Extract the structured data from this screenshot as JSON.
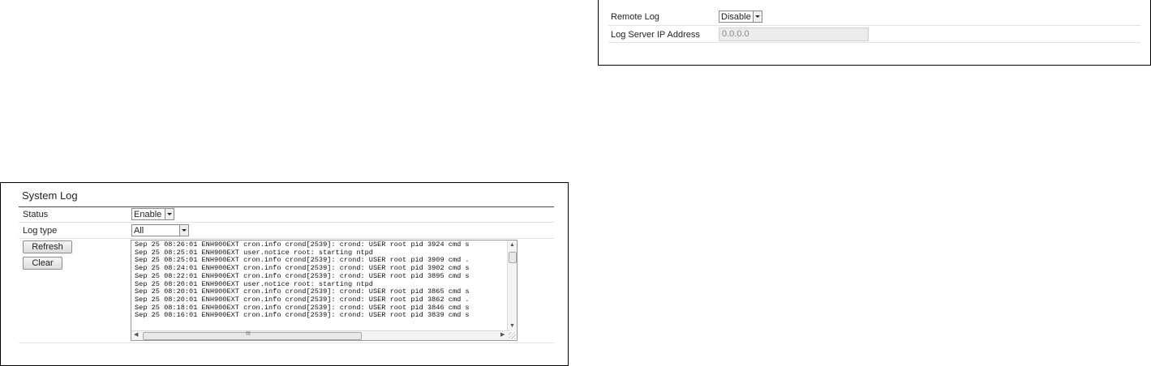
{
  "system_log": {
    "title": "System Log",
    "status_label": "Status",
    "status_value": "Enable",
    "log_type_label": "Log type",
    "log_type_value": "All",
    "refresh_label": "Refresh",
    "clear_label": "Clear",
    "log_lines": [
      "Sep 25 08:26:01 ENH900EXT cron.info crond[2539]: crond: USER root pid 3924 cmd s",
      "Sep 25 08:25:01 ENH900EXT user.notice root: starting ntpd",
      "Sep 25 08:25:01 ENH900EXT cron.info crond[2539]: crond: USER root pid 3909 cmd .",
      "Sep 25 08:24:01 ENH900EXT cron.info crond[2539]: crond: USER root pid 3902 cmd s",
      "Sep 25 08:22:01 ENH900EXT cron.info crond[2539]: crond: USER root pid 3895 cmd s",
      "Sep 25 08:20:01 ENH900EXT user.notice root: starting ntpd",
      "Sep 25 08:20:01 ENH900EXT cron.info crond[2539]: crond: USER root pid 3865 cmd s",
      "Sep 25 08:20:01 ENH900EXT cron.info crond[2539]: crond: USER root pid 3862 cmd .",
      "Sep 25 08:18:01 ENH900EXT cron.info crond[2539]: crond: USER root pid 3846 cmd s",
      "Sep 25 08:16:01 ENH900EXT cron.info crond[2539]: crond: USER root pid 3839 cmd s"
    ],
    "hscroll_mark": "III"
  },
  "remote_log": {
    "remote_log_label": "Remote Log",
    "remote_log_value": "Disable",
    "server_ip_label": "Log Server IP Address",
    "server_ip_value": "0.0.0.0"
  },
  "icons": {
    "dropdown": "chevron-down-icon",
    "scroll_up": "arrow-up-icon",
    "scroll_down": "arrow-down-icon",
    "scroll_left": "arrow-left-icon",
    "scroll_right": "arrow-right-icon",
    "resize": "resize-grip-icon"
  },
  "colors": {
    "title_rule": "#1e4e8c",
    "row_rule": "#e3e3e3",
    "disabled_field_bg": "#ececec"
  }
}
